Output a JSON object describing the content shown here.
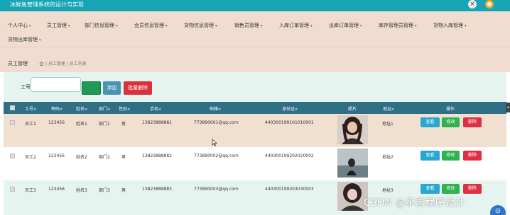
{
  "app": {
    "title": "冰鲜鱼管理系统的设计与实现"
  },
  "topbar": {
    "tools_icon": "close-circle-icon",
    "avatar_icon": "user-avatar-icon"
  },
  "nav": {
    "items": [
      {
        "label": "个人中心"
      },
      {
        "label": "员工管理"
      },
      {
        "label": "部门信息管理"
      },
      {
        "label": "会员信息管理"
      },
      {
        "label": "货物信息管理"
      },
      {
        "label": "销售员管理"
      },
      {
        "label": "入库订单管理"
      },
      {
        "label": "出库订单管理"
      },
      {
        "label": "库存管理员管理"
      },
      {
        "label": "货物入库管理"
      },
      {
        "label": "货物出库管理"
      }
    ],
    "caret": "▾"
  },
  "breadcrumb": {
    "title": "员工管理",
    "path": "| 员工管理 | 员工列表"
  },
  "search": {
    "label": "工号",
    "value": "",
    "placeholder": "",
    "search_label": "",
    "add_label": "添加",
    "batch_delete_label": "批量删除"
  },
  "table": {
    "columns": {
      "emp_no": "工号",
      "password": "密码",
      "name": "姓名",
      "department": "部门",
      "gender": "性别",
      "phone": "手机",
      "email": "邮箱",
      "id_card": "身份证",
      "photo": "照片",
      "address": "地址",
      "actions": "操作"
    },
    "sort_marker": "≑",
    "rows": [
      {
        "emp_no": "员工1",
        "password": "123456",
        "name": "姓名1",
        "department": "部门1",
        "gender": "男",
        "phone": "13823888881",
        "email": "773890001@qq.com",
        "id_card": "440300199101010001",
        "address": "地址1"
      },
      {
        "emp_no": "员工2",
        "password": "123456",
        "name": "姓名2",
        "department": "部门2",
        "gender": "男",
        "phone": "13823888882",
        "email": "773890002@qq.com",
        "id_card": "440300199202020002",
        "address": "地址2"
      },
      {
        "emp_no": "员工3",
        "password": "123456",
        "name": "姓名3",
        "department": "部门3",
        "gender": "男",
        "phone": "13823888883",
        "email": "773890003@qq.com",
        "id_card": "440300199303030003",
        "address": "地址3"
      }
    ],
    "actions": {
      "view": "查看",
      "edit": "修改",
      "delete": "删除"
    }
  },
  "watermark": "CSDN @承志程序设计",
  "colors": {
    "topbar": "#17a4b4",
    "nav_bg": "#f1ddd0",
    "table_head": "#2e6f86",
    "view_btn": "#28a8cf",
    "edit_btn": "#2fb351",
    "delete_btn": "#df2f44",
    "search_btn": "#1f9a55",
    "add_btn": "#4a93b5",
    "batch_delete_btn": "#d9323e"
  }
}
